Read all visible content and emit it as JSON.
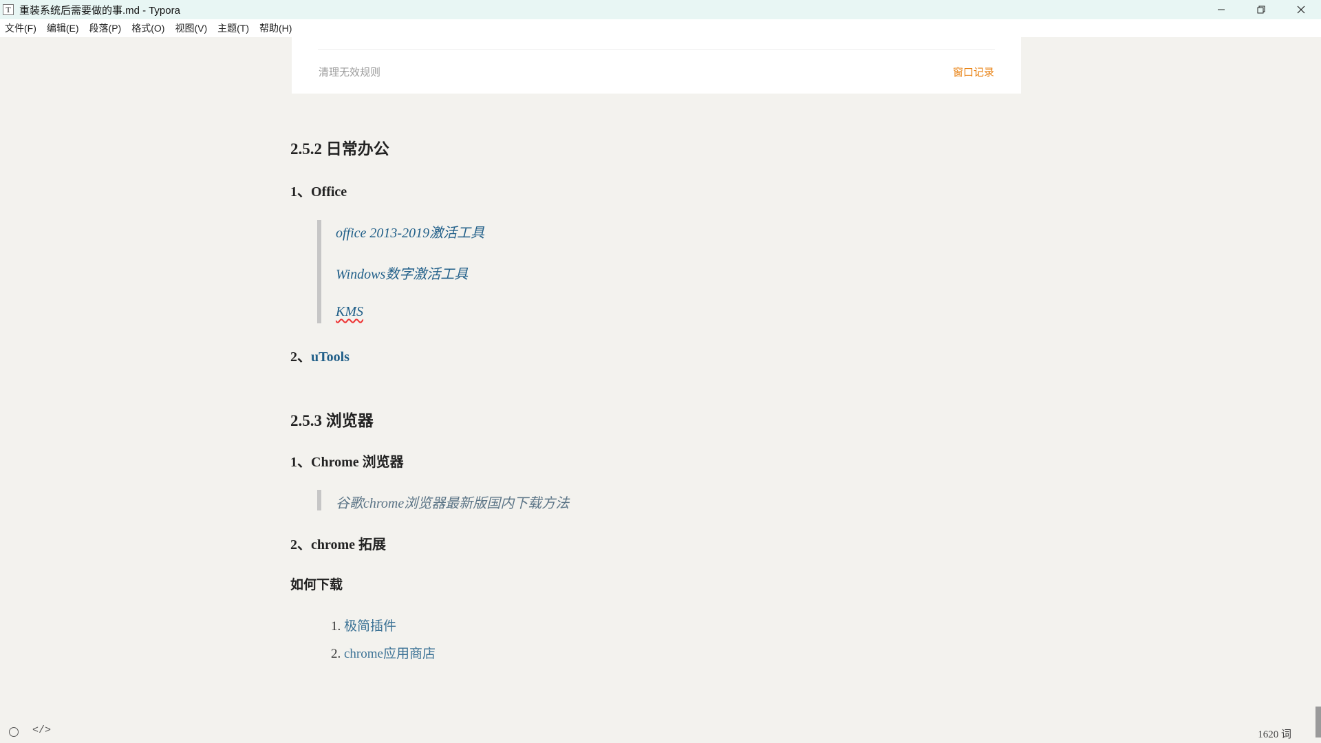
{
  "window": {
    "app_icon": "T",
    "title": "重装系统后需要做的事.md - Typora",
    "controls": [
      "minimize-icon",
      "restore-icon",
      "close-icon"
    ]
  },
  "menu": [
    "文件(F)",
    "编辑(E)",
    "段落(P)",
    "格式(O)",
    "视图(V)",
    "主题(T)",
    "帮助(H)"
  ],
  "embed": {
    "left_link": "清理无效规则",
    "right_link": "窗口记录",
    "accent_color": "#e87f0e"
  },
  "content": {
    "h_office_section": "2.5.2 日常办公",
    "office_item": "1、Office",
    "office_quotes": [
      "office 2013-2019激活工具",
      "Windows数字激活工具",
      "KMS"
    ],
    "utools_prefix": "2、",
    "utools_link": "uTools",
    "h_browser_section": "2.5.3 浏览器",
    "chrome_item": "1、Chrome 浏览器",
    "chrome_quote": "谷歌chrome浏览器最新版国内下载方法",
    "ext_item": "2、chrome 拓展",
    "how_download": "如何下载",
    "download_list": [
      {
        "num": "1.",
        "text": "极简插件"
      },
      {
        "num": "2.",
        "text": "chrome应用商店"
      }
    ],
    "link_color": "#1f5e88"
  },
  "status": {
    "word_count": "1620 词",
    "left_icons": [
      "outline-toggle-icon",
      "source-code-icon"
    ]
  }
}
